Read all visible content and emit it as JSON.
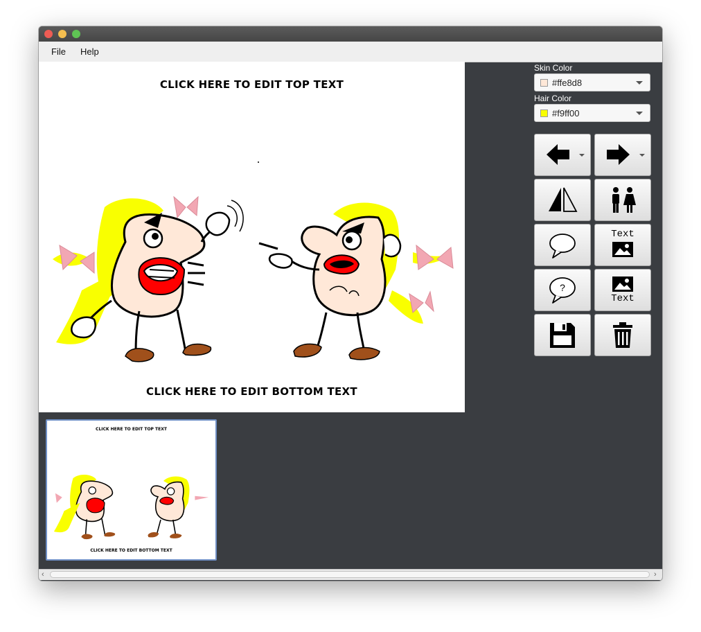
{
  "menu": {
    "file": "File",
    "help": "Help"
  },
  "meme": {
    "top_text": "CLICK HERE TO EDIT TOP TEXT",
    "bottom_text": "CLICK HERE TO EDIT BOTTOM TEXT"
  },
  "thumbnail": {
    "top_text": "CLICK HERE TO EDIT TOP TEXT",
    "bottom_text": "CLICK HERE TO EDIT BOTTOM TEXT"
  },
  "skin_color": {
    "label": "Skin Color",
    "value": "#ffe8d8",
    "swatch": "#ffe8d8"
  },
  "hair_color": {
    "label": "Hair Color",
    "value": "#f9ff00",
    "swatch": "#f9ff00"
  },
  "tools": {
    "add_text_top_label": "Text",
    "add_text_bottom_label": "Text",
    "icons": [
      "arrow-left-icon",
      "arrow-right-icon",
      "mirror-icon",
      "couple-icon",
      "speech-bubble-icon",
      "text-above-image-icon",
      "question-bubble-icon",
      "text-below-image-icon",
      "save-icon",
      "trash-icon"
    ]
  }
}
